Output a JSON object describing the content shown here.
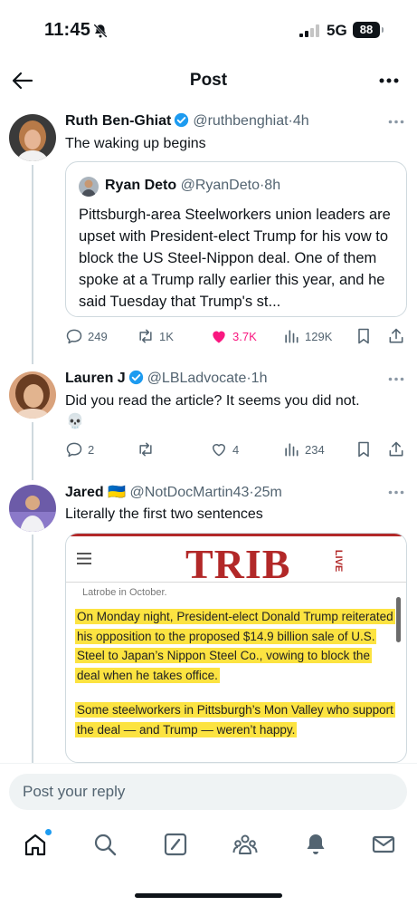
{
  "status_bar": {
    "time": "11:45",
    "network": "5G",
    "battery": "88"
  },
  "header": {
    "title": "Post"
  },
  "main_post": {
    "name": "Ruth Ben-Ghiat",
    "handle": "@ruthbenghiat",
    "time": "4h",
    "text": "The waking up begins",
    "quote": {
      "name": "Ryan Deto",
      "handle": "@RyanDeto",
      "time": "8h",
      "text": "Pittsburgh-area Steelworkers union leaders are upset with President-elect Trump for his vow to block the US Steel-Nippon deal. One of them spoke at a Trump rally earlier this year, and he said Tuesday that Trump's st..."
    },
    "actions": {
      "replies": "249",
      "reposts": "1K",
      "likes": "3.7K",
      "views": "129K"
    }
  },
  "reply_1": {
    "name": "Lauren J",
    "handle": "@LBLadvocate",
    "time": "1h",
    "text": "Did you read the article? It seems you did not.",
    "emoji": "💀",
    "actions": {
      "replies": "2",
      "reposts": "",
      "likes": "4",
      "views": "234"
    }
  },
  "reply_2": {
    "name": "Jared",
    "flag": "🇺🇦",
    "handle": "@NotDocMartin43",
    "time": "25m",
    "text": "Literally the first two sentences",
    "article": {
      "logo": "TRIB",
      "logo_sub": "LIVE",
      "caption": "Latrobe in October.",
      "paragraph_1": "On Monday night, President-elect Donald Trump reiterated his opposition to the proposed $14.9 billion sale of U.S. Steel to Japan’s Nippon Steel Co., vowing to block the deal when he takes office.",
      "paragraph_2": "Some steelworkers in Pittsburgh’s Mon Valley who support the deal — and Trump — weren’t happy."
    }
  },
  "reply_bar": {
    "placeholder": "Post your reply"
  },
  "icons": {
    "back": "arrow-left-icon",
    "more": "more-icon",
    "verified": "verified-badge-icon",
    "reply": "reply-icon",
    "repost": "repost-icon",
    "like": "heart-icon",
    "views": "views-icon",
    "bookmark": "bookmark-icon",
    "share": "share-icon",
    "tabs": [
      "home-icon",
      "search-icon",
      "compose-icon",
      "communities-icon",
      "notifications-icon",
      "messages-icon"
    ]
  },
  "colors": {
    "accent": "#1d9bf0",
    "like": "#f91880",
    "highlight": "#fce341",
    "trib_red": "#b22828"
  }
}
